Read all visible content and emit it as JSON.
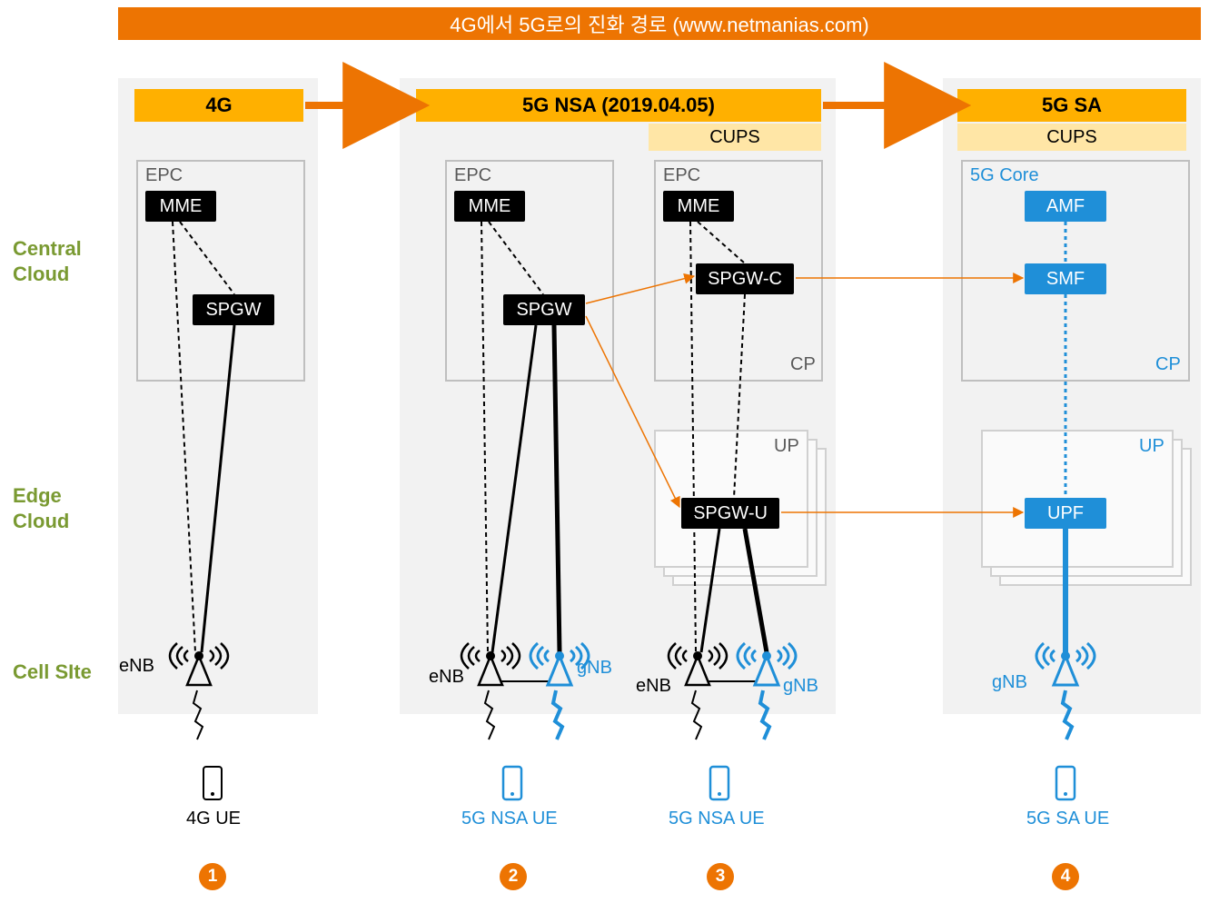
{
  "title": "4G에서 5G로의 진화 경로 (www.netmanias.com)",
  "side_labels": {
    "central": "Central\nCloud",
    "edge": "Edge\nCloud",
    "cell": "Cell SIte"
  },
  "columns": {
    "c1": {
      "header": "4G",
      "epc_label": "EPC",
      "mme": "MME",
      "spgw": "SPGW",
      "enb": "eNB",
      "ue": "4G UE"
    },
    "c2": {
      "header": "5G NSA (2019.04.05)",
      "epc_label": "EPC",
      "mme": "MME",
      "spgw": "SPGW",
      "enb": "eNB",
      "gnb": "gNB",
      "ue": "5G NSA UE"
    },
    "c3": {
      "cups": "CUPS",
      "epc_label": "EPC",
      "mme": "MME",
      "spgw_c": "SPGW-C",
      "spgw_u": "SPGW-U",
      "cp": "CP",
      "up": "UP",
      "enb": "eNB",
      "gnb": "gNB",
      "ue": "5G NSA UE"
    },
    "c4": {
      "header": "5G SA",
      "cups": "CUPS",
      "core_label": "5G Core",
      "amf": "AMF",
      "smf": "SMF",
      "upf": "UPF",
      "cp": "CP",
      "up": "UP",
      "gnb": "gNB",
      "ue": "5G SA UE"
    }
  },
  "badges": {
    "n1": "1",
    "n2": "2",
    "n3": "3",
    "n4": "4"
  }
}
